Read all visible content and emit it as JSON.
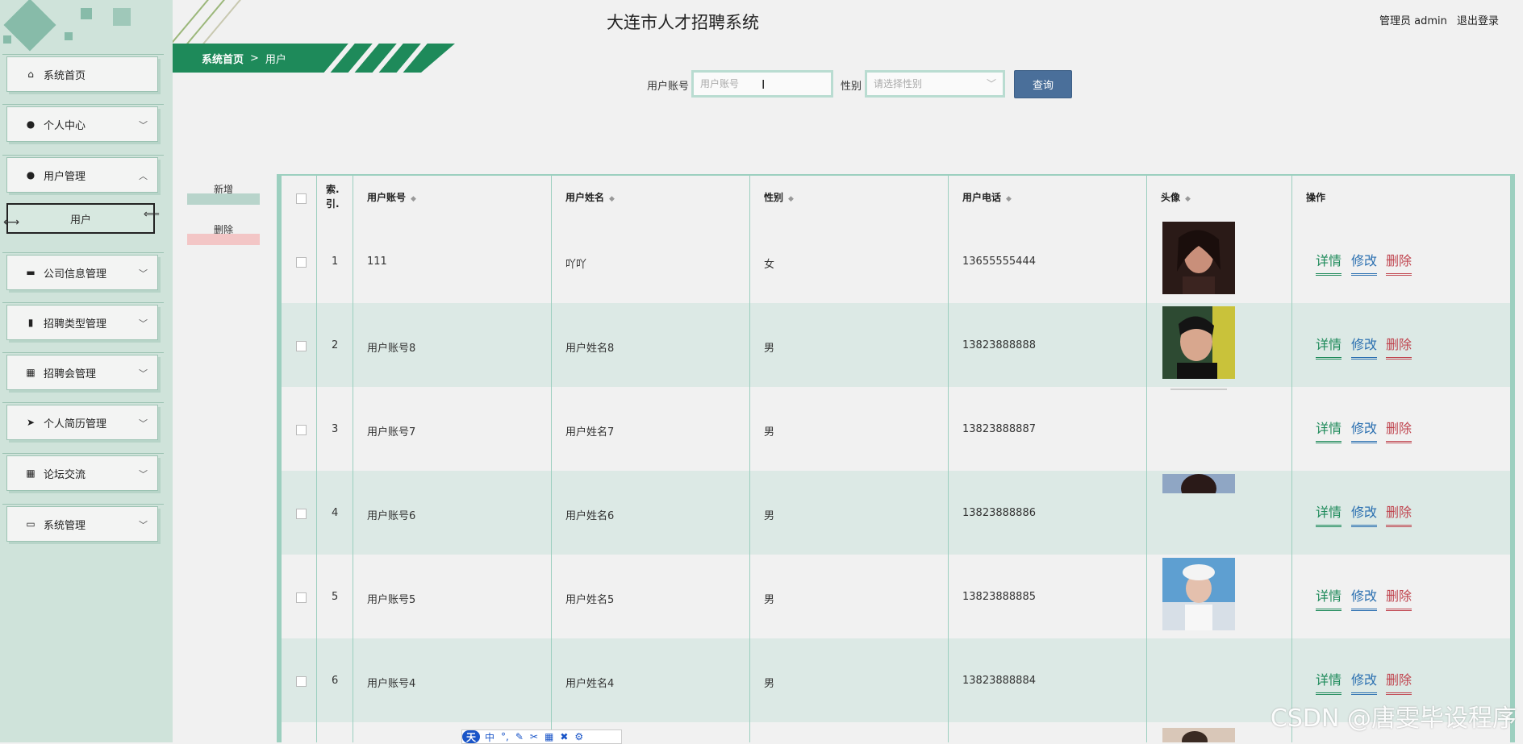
{
  "app_title": "大连市人才招聘系统",
  "user": {
    "label": "管理员 admin",
    "logout": "退出登录"
  },
  "breadcrumb": {
    "home": "系统首页",
    "sep": ">",
    "current": "用户"
  },
  "search": {
    "account_label": "用户账号",
    "account_placeholder": "用户账号",
    "gender_label": "性别",
    "gender_placeholder": "请选择性别",
    "query_button": "查询"
  },
  "actions": {
    "add": "新增",
    "delete": "删除"
  },
  "sidebar": {
    "items": [
      {
        "label": "系统首页",
        "icon": "home-icon"
      },
      {
        "label": "个人中心",
        "icon": "person-icon"
      },
      {
        "label": "用户管理",
        "icon": "bulb-icon"
      },
      {
        "label": "公司信息管理",
        "icon": "briefcase-icon"
      },
      {
        "label": "招聘类型管理",
        "icon": "chart-icon"
      },
      {
        "label": "招聘会管理",
        "icon": "grid-icon"
      },
      {
        "label": "个人简历管理",
        "icon": "send-icon"
      },
      {
        "label": "论坛交流",
        "icon": "grid-icon"
      },
      {
        "label": "系统管理",
        "icon": "monitor-icon"
      }
    ],
    "sub_item": "用户"
  },
  "table": {
    "headers": {
      "index": "索.引.",
      "account": "用户账号",
      "name": "用户姓名",
      "gender": "性别",
      "phone": "用户电话",
      "avatar": "头像",
      "ops": "操作"
    },
    "op_labels": {
      "detail": "详情",
      "edit": "修改",
      "del": "删除"
    },
    "rows": [
      {
        "index": "1",
        "account": "111",
        "name": "吖吖",
        "gender": "女",
        "phone": "13655555444"
      },
      {
        "index": "2",
        "account": "用户账号8",
        "name": "用户姓名8",
        "gender": "男",
        "phone": "13823888888"
      },
      {
        "index": "3",
        "account": "用户账号7",
        "name": "用户姓名7",
        "gender": "男",
        "phone": "13823888887"
      },
      {
        "index": "4",
        "account": "用户账号6",
        "name": "用户姓名6",
        "gender": "男",
        "phone": "13823888886"
      },
      {
        "index": "5",
        "account": "用户账号5",
        "name": "用户姓名5",
        "gender": "男",
        "phone": "13823888885"
      },
      {
        "index": "6",
        "account": "用户账号4",
        "name": "用户姓名4",
        "gender": "男",
        "phone": "13823888884"
      }
    ]
  },
  "ime": {
    "logo": "天",
    "mode": "中"
  },
  "watermark": "CSDN @唐雯毕设程序"
}
